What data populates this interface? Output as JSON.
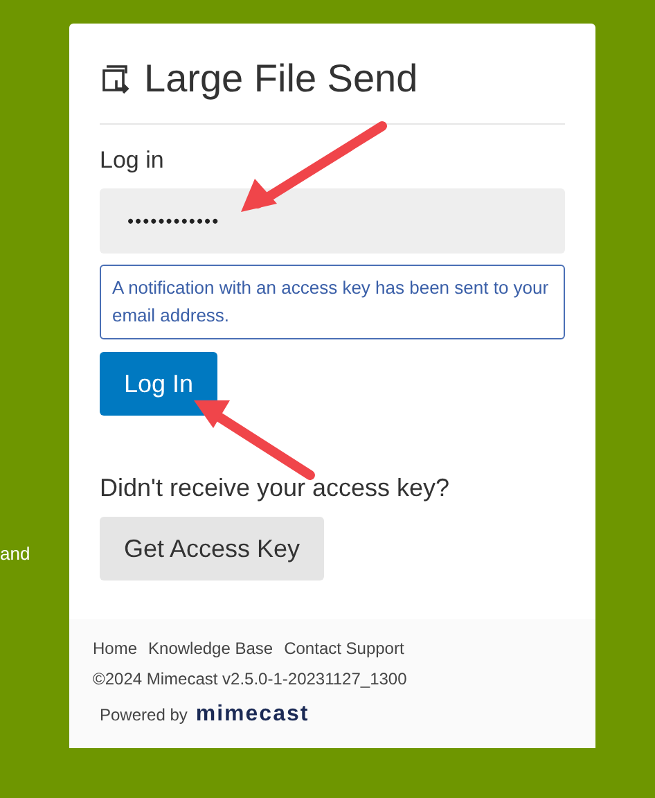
{
  "background": {
    "text_fragment": "and"
  },
  "card": {
    "title": "Large File Send",
    "section_label": "Log in",
    "password_field": {
      "value": "••••••••••••"
    },
    "notice": "A notification with an access key has been sent to your email address.",
    "login_button": "Log In",
    "resend_prompt": "Didn't receive your access key?",
    "access_key_button": "Get Access Key"
  },
  "footer": {
    "links": [
      {
        "label": "Home"
      },
      {
        "label": "Knowledge Base"
      },
      {
        "label": "Contact Support"
      }
    ],
    "copyright": "©2024 Mimecast v2.5.0-1-20231127_1300",
    "powered_by": "Powered by",
    "brand": "mimecast"
  }
}
